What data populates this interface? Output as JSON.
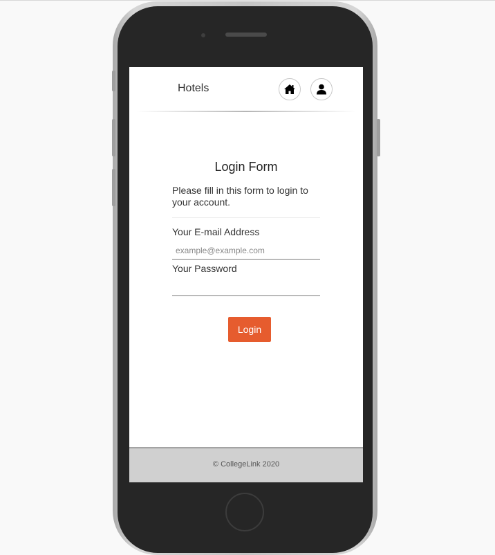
{
  "navbar": {
    "brand": "Hotels",
    "icons": [
      "home-icon",
      "user-icon"
    ]
  },
  "form": {
    "title": "Login Form",
    "description": "Please fill in this form to login to your account.",
    "email_label": "Your E-mail Address",
    "email_placeholder": "example@example.com",
    "email_value": "",
    "password_label": "Your Password",
    "password_value": "",
    "submit_label": "Login"
  },
  "footer": {
    "text": "© CollegeLink 2020"
  },
  "colors": {
    "accent": "#e65c2e",
    "footer_bg": "#d0d0d0",
    "phone_body": "#262626"
  }
}
